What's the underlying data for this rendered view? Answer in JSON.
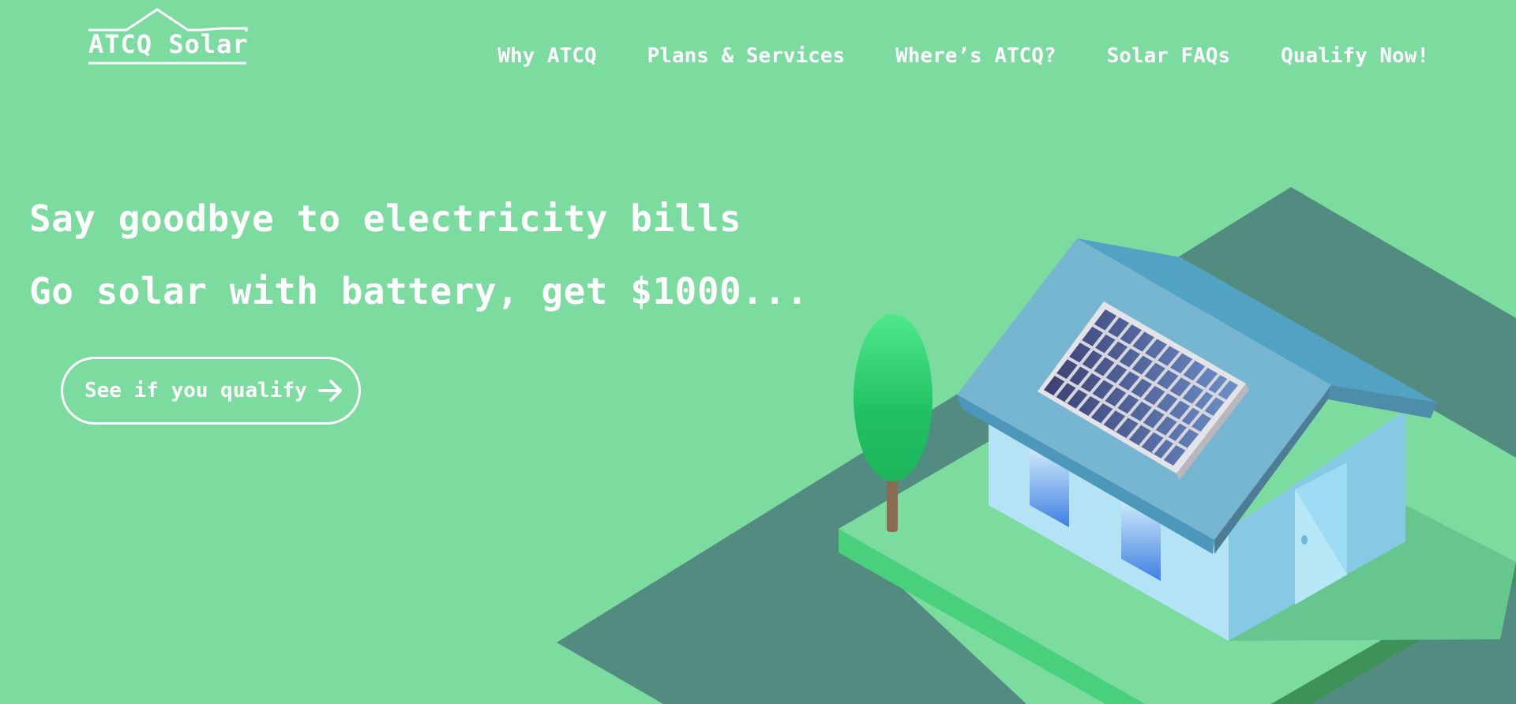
{
  "brand": {
    "name": "ATCQ Solar"
  },
  "nav": {
    "items": [
      {
        "label": "Why ATCQ"
      },
      {
        "label": "Plans & Services"
      },
      {
        "label": "Where’s ATCQ?"
      },
      {
        "label": "Solar FAQs"
      },
      {
        "label": "Qualify Now!"
      }
    ]
  },
  "hero": {
    "headline_1": "Say goodbye to electricity bills",
    "headline_2": "Go solar with battery, get $1000...",
    "cta_label": "See if you qualify",
    "cta_icon": "arrow-right-icon"
  },
  "illustration": {
    "icon": "solar-house-illustration"
  },
  "colors": {
    "background": "#7cdca0",
    "text": "#ffffff",
    "ground": "#528b80",
    "roof": "#76b6d1",
    "wall": "#b3e3f5",
    "panel": "#4a5a94",
    "tree": "#2ec768"
  }
}
